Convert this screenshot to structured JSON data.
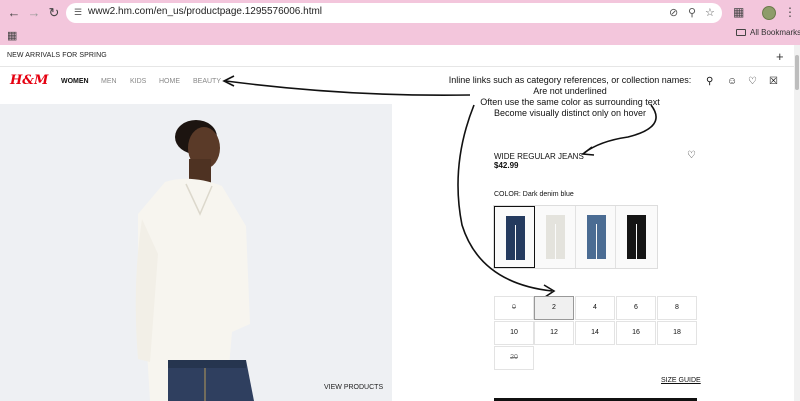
{
  "browser": {
    "url": "www2.hm.com/en_us/productpage.1295576006.html",
    "bookmarks_label": "All Bookmarks"
  },
  "promo": {
    "text": "NEW ARRIVALS FOR SPRING",
    "plus": "+"
  },
  "header": {
    "logo": "H&M",
    "categories": [
      "WOMEN",
      "MEN",
      "KIDS",
      "HOME",
      "BEAUTY"
    ],
    "active_category": "WOMEN"
  },
  "annotation": {
    "lines": [
      "Inline links such as category references, or collection names:",
      "Are not underlined",
      "Often use the same color as surrounding text",
      "Become visually distinct only on hover"
    ]
  },
  "gallery": {
    "view_products": "VIEW PRODUCTS"
  },
  "product": {
    "name": "WIDE REGULAR JEANS",
    "price": "$42.99",
    "color_label": "COLOR: Dark denim blue",
    "swatches": [
      {
        "name": "dark-denim-blue",
        "color": "#243a5e",
        "selected": true
      },
      {
        "name": "white",
        "color": "#ecebe6",
        "selected": false
      },
      {
        "name": "light-denim-blue",
        "color": "#4b6c93",
        "selected": false
      },
      {
        "name": "black",
        "color": "#151515",
        "selected": false
      }
    ],
    "sizes": [
      {
        "label": "0",
        "available": false,
        "selected": false
      },
      {
        "label": "2",
        "available": true,
        "selected": true
      },
      {
        "label": "4",
        "available": true,
        "selected": false
      },
      {
        "label": "6",
        "available": true,
        "selected": false
      },
      {
        "label": "8",
        "available": true,
        "selected": false
      },
      {
        "label": "10",
        "available": true,
        "selected": false
      },
      {
        "label": "12",
        "available": true,
        "selected": false
      },
      {
        "label": "14",
        "available": true,
        "selected": false
      },
      {
        "label": "16",
        "available": true,
        "selected": false
      },
      {
        "label": "18",
        "available": true,
        "selected": false
      },
      {
        "label": "20",
        "available": false,
        "selected": false
      }
    ],
    "size_guide": "SIZE GUIDE"
  },
  "colors": {
    "chrome": "#f3c6dc",
    "brand_red": "#e50010"
  }
}
